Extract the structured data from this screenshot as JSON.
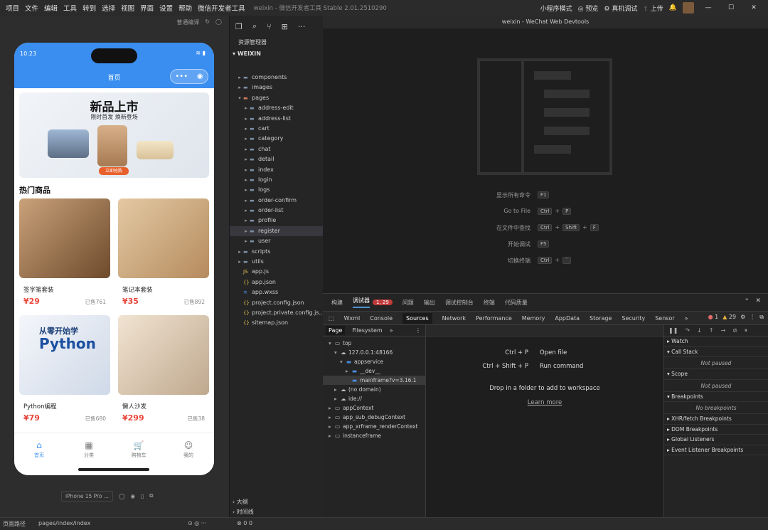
{
  "menu": {
    "items": [
      "项目",
      "文件",
      "编辑",
      "工具",
      "转到",
      "选择",
      "视图",
      "界面",
      "设置",
      "帮助",
      "微信开发者工具"
    ],
    "title": "weixin - 微信开发者工具 Stable 2.01.2510290",
    "mode": "小程序模式",
    "preview": "预览",
    "debug": "真机调试",
    "upload": "上传"
  },
  "simulator": {
    "toolbar": "普通编译",
    "status_time": "10:23",
    "nav_title": "首页",
    "banner_title": "新品上市",
    "banner_sub": "限时首发 焕新登场",
    "banner_button": "立即抢购",
    "section_title": "热门商品",
    "products": [
      {
        "name": "签字笔套装",
        "price": "¥29",
        "sold": "已售761"
      },
      {
        "name": "笔记本套装",
        "price": "¥35",
        "sold": "已售892"
      },
      {
        "name": "Python编程",
        "price": "¥79",
        "sold": "已售680"
      },
      {
        "name": "懒人沙发",
        "price": "¥299",
        "sold": "已售38"
      }
    ],
    "book_cover_title": "从零开始学",
    "book_cover_big": "Python",
    "tabs": [
      "首页",
      "分类",
      "购物车",
      "我的"
    ],
    "device": "iPhone 15 Pro ..."
  },
  "explorer": {
    "header": "资源管理器",
    "root": "WEIXIN",
    "items": [
      {
        "label": "components",
        "depth": 1,
        "type": "folder",
        "arrow": "▸"
      },
      {
        "label": "images",
        "depth": 1,
        "type": "folder",
        "arrow": "▸"
      },
      {
        "label": "pages",
        "depth": 1,
        "type": "folder-open",
        "arrow": "▾"
      },
      {
        "label": "address-edit",
        "depth": 2,
        "type": "folder",
        "arrow": "▸"
      },
      {
        "label": "address-list",
        "depth": 2,
        "type": "folder",
        "arrow": "▸"
      },
      {
        "label": "cart",
        "depth": 2,
        "type": "folder",
        "arrow": "▸"
      },
      {
        "label": "category",
        "depth": 2,
        "type": "folder",
        "arrow": "▸"
      },
      {
        "label": "chat",
        "depth": 2,
        "type": "folder",
        "arrow": "▸"
      },
      {
        "label": "detail",
        "depth": 2,
        "type": "folder",
        "arrow": "▸"
      },
      {
        "label": "index",
        "depth": 2,
        "type": "folder",
        "arrow": "▸"
      },
      {
        "label": "login",
        "depth": 2,
        "type": "folder",
        "arrow": "▸"
      },
      {
        "label": "logs",
        "depth": 2,
        "type": "folder",
        "arrow": "▸"
      },
      {
        "label": "order-confirm",
        "depth": 2,
        "type": "folder",
        "arrow": "▸"
      },
      {
        "label": "order-list",
        "depth": 2,
        "type": "folder",
        "arrow": "▸"
      },
      {
        "label": "profile",
        "depth": 2,
        "type": "folder",
        "arrow": "▸"
      },
      {
        "label": "register",
        "depth": 2,
        "type": "folder",
        "arrow": "▸",
        "selected": true
      },
      {
        "label": "user",
        "depth": 2,
        "type": "folder",
        "arrow": "▸"
      },
      {
        "label": "scripts",
        "depth": 1,
        "type": "folder",
        "arrow": "▸"
      },
      {
        "label": "utils",
        "depth": 1,
        "type": "folder",
        "arrow": "▸"
      },
      {
        "label": "app.js",
        "depth": 1,
        "type": "js",
        "arrow": ""
      },
      {
        "label": "app.json",
        "depth": 1,
        "type": "json",
        "arrow": ""
      },
      {
        "label": "app.wxss",
        "depth": 1,
        "type": "css",
        "arrow": ""
      },
      {
        "label": "project.config.json",
        "depth": 1,
        "type": "json",
        "arrow": ""
      },
      {
        "label": "project.private.config.js...",
        "depth": 1,
        "type": "json",
        "arrow": ""
      },
      {
        "label": "sitemap.json",
        "depth": 1,
        "type": "json",
        "arrow": ""
      }
    ],
    "outline": "大纲",
    "timeline": "时间线"
  },
  "editor": {
    "title": "weixin - WeChat Web Devtools",
    "shortcuts": [
      {
        "label": "显示所有命令",
        "keys": [
          "F1"
        ]
      },
      {
        "label": "Go to File",
        "keys": [
          "Ctrl",
          "+",
          "P"
        ]
      },
      {
        "label": "在文件中查找",
        "keys": [
          "Ctrl",
          "+",
          "Shift",
          "+",
          "F"
        ]
      },
      {
        "label": "开始调试",
        "keys": [
          "F5"
        ]
      },
      {
        "label": "切换终端",
        "keys": [
          "Ctrl",
          "+",
          "`"
        ]
      }
    ]
  },
  "devtools": {
    "top_tabs": [
      "构建",
      "调试器",
      "问题",
      "输出",
      "调试控制台",
      "终端",
      "代码质量"
    ],
    "debugger_badge": "1, 29",
    "panel_tabs": [
      "Wxml",
      "Console",
      "Sources",
      "Network",
      "Performance",
      "Memory",
      "AppData",
      "Storage",
      "Security",
      "Sensor"
    ],
    "errors": "1",
    "warnings": "29",
    "sub_tabs": [
      "Page",
      "Filesystem"
    ],
    "tree": [
      {
        "label": "top",
        "indent": 0,
        "arrow": "▾"
      },
      {
        "label": "127.0.0.1:48166",
        "indent": 1,
        "arrow": "▾"
      },
      {
        "label": "appservice",
        "indent": 2,
        "arrow": "▾"
      },
      {
        "label": "__dev__",
        "indent": 3,
        "arrow": "▸"
      },
      {
        "label": "mainframe?v=3.16.1",
        "indent": 3,
        "arrow": "",
        "selected": true
      },
      {
        "label": "(no domain)",
        "indent": 1,
        "arrow": "▸"
      },
      {
        "label": "ide://",
        "indent": 1,
        "arrow": "▸"
      },
      {
        "label": "appContext",
        "indent": 0,
        "arrow": "▸"
      },
      {
        "label": "app_sub_debugContext",
        "indent": 0,
        "arrow": "▸"
      },
      {
        "label": "app_xrframe_renderContext",
        "indent": 0,
        "arrow": "▸"
      },
      {
        "label": "instanceframe",
        "indent": 0,
        "arrow": "▸"
      }
    ],
    "hints": [
      {
        "key": "Ctrl + P",
        "label": "Open file"
      },
      {
        "key": "Ctrl + Shift + P",
        "label": "Run command"
      }
    ],
    "drop_hint": "Drop in a folder to add to workspace",
    "learn_more": "Learn more",
    "right_panes": [
      {
        "title": "Watch",
        "arrow": "▸",
        "body": ""
      },
      {
        "title": "Call Stack",
        "arrow": "▾",
        "body": "Not paused"
      },
      {
        "title": "Scope",
        "arrow": "▾",
        "body": "Not paused"
      },
      {
        "title": "Breakpoints",
        "arrow": "▾",
        "body": "No breakpoints"
      },
      {
        "title": "XHR/fetch Breakpoints",
        "arrow": "▸",
        "body": ""
      },
      {
        "title": "DOM Breakpoints",
        "arrow": "▸",
        "body": ""
      },
      {
        "title": "Global Listeners",
        "arrow": "▸",
        "body": ""
      },
      {
        "title": "Event Listener Breakpoints",
        "arrow": "▸",
        "body": ""
      }
    ]
  },
  "status": {
    "path_label": "页面路径",
    "path": "pages/index/index",
    "counts": "0  0"
  }
}
